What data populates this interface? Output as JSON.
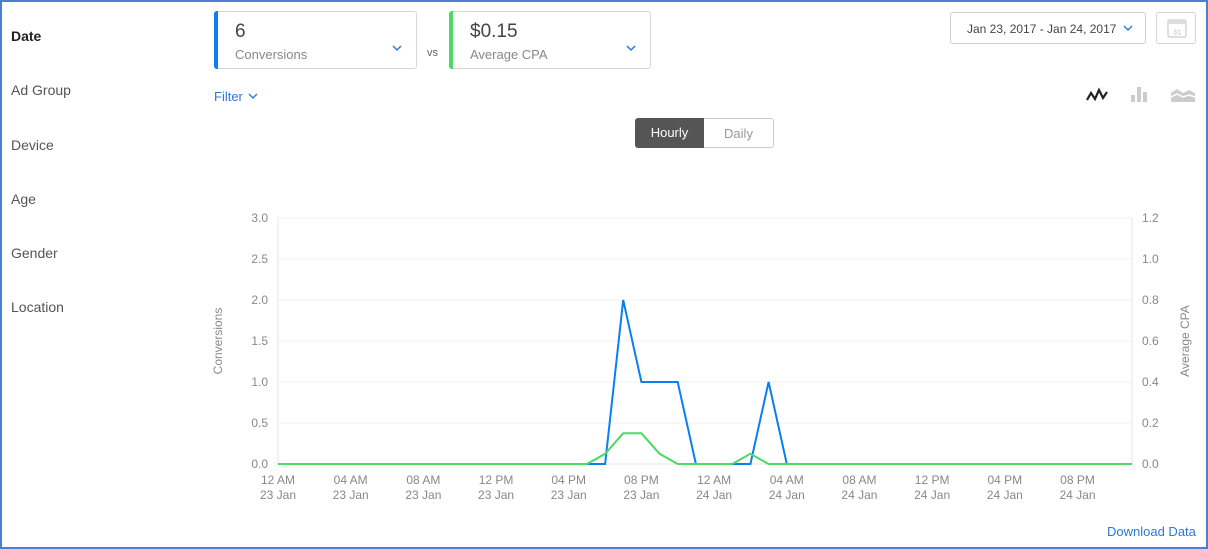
{
  "nav": {
    "items": [
      {
        "label": "Date",
        "active": true
      },
      {
        "label": "Ad Group",
        "active": false
      },
      {
        "label": "Device",
        "active": false
      },
      {
        "label": "Age",
        "active": false
      },
      {
        "label": "Gender",
        "active": false
      },
      {
        "label": "Location",
        "active": false
      }
    ]
  },
  "metrics": {
    "primary": {
      "value": "6",
      "label": "Conversions",
      "color": "#0a7ff0"
    },
    "vs": "vs",
    "secondary": {
      "value": "$0.15",
      "label": "Average CPA",
      "color": "#4cd964"
    }
  },
  "filter": {
    "label": "Filter"
  },
  "date_range": {
    "label": "Jan 23, 2017 - Jan 24, 2017"
  },
  "calendar": {
    "day": "31"
  },
  "chart_types": [
    "line-chart-icon",
    "bar-chart-icon",
    "area-chart-icon"
  ],
  "granularity": {
    "options": [
      "Hourly",
      "Daily"
    ],
    "selected": "Hourly"
  },
  "download": {
    "label": "Download Data"
  },
  "chart_data": {
    "type": "line",
    "x_ticks": [
      {
        "index": 0,
        "time": "12 AM",
        "date": "23 Jan"
      },
      {
        "index": 4,
        "time": "04 AM",
        "date": "23 Jan"
      },
      {
        "index": 8,
        "time": "08 AM",
        "date": "23 Jan"
      },
      {
        "index": 12,
        "time": "12 PM",
        "date": "23 Jan"
      },
      {
        "index": 16,
        "time": "04 PM",
        "date": "23 Jan"
      },
      {
        "index": 20,
        "time": "08 PM",
        "date": "23 Jan"
      },
      {
        "index": 24,
        "time": "12 AM",
        "date": "24 Jan"
      },
      {
        "index": 28,
        "time": "04 AM",
        "date": "24 Jan"
      },
      {
        "index": 32,
        "time": "08 AM",
        "date": "24 Jan"
      },
      {
        "index": 36,
        "time": "12 PM",
        "date": "24 Jan"
      },
      {
        "index": 40,
        "time": "04 PM",
        "date": "24 Jan"
      },
      {
        "index": 44,
        "time": "08 PM",
        "date": "24 Jan"
      }
    ],
    "y_left": {
      "label": "Conversions",
      "ticks": [
        "0.0",
        "0.5",
        "1.0",
        "1.5",
        "2.0",
        "2.5",
        "3.0"
      ],
      "lim": [
        0,
        3
      ]
    },
    "y_right": {
      "label": "Average CPA",
      "ticks": [
        "0.0",
        "0.2",
        "0.4",
        "0.6",
        "0.8",
        "1.0",
        "1.2"
      ],
      "lim": [
        0,
        1.2
      ]
    },
    "series": [
      {
        "name": "Conversions",
        "axis": "left",
        "color": "#0a7ff0",
        "values": [
          0,
          0,
          0,
          0,
          0,
          0,
          0,
          0,
          0,
          0,
          0,
          0,
          0,
          0,
          0,
          0,
          0,
          0,
          0,
          2,
          1,
          1,
          1,
          0,
          0,
          0,
          0,
          1,
          0,
          0,
          0,
          0,
          0,
          0,
          0,
          0,
          0,
          0,
          0,
          0,
          0,
          0,
          0,
          0,
          0,
          0,
          0,
          0
        ]
      },
      {
        "name": "Average CPA",
        "axis": "right",
        "color": "#4cd964",
        "values": [
          0,
          0,
          0,
          0,
          0,
          0,
          0,
          0,
          0,
          0,
          0,
          0,
          0,
          0,
          0,
          0,
          0,
          0,
          0.05,
          0.15,
          0.15,
          0.05,
          0,
          0,
          0,
          0,
          0.05,
          0,
          0,
          0,
          0,
          0,
          0,
          0,
          0,
          0,
          0,
          0,
          0,
          0,
          0,
          0,
          0,
          0,
          0,
          0,
          0,
          0
        ]
      }
    ]
  }
}
